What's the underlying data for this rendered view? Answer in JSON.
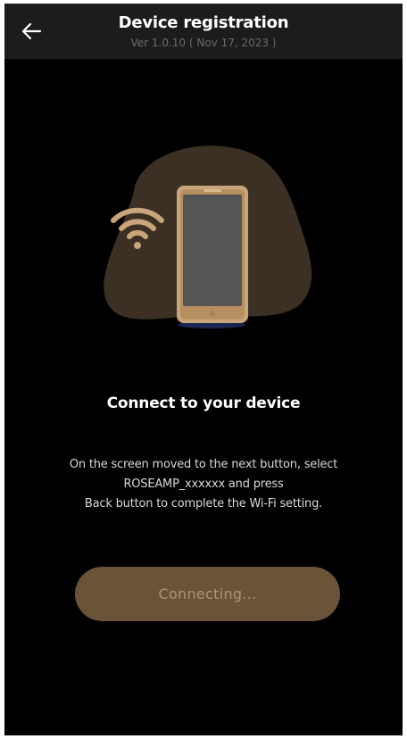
{
  "header": {
    "title": "Device registration",
    "version": "Ver 1.0.10 ( Nov 17, 2023 )",
    "back_icon": "arrow-left-icon"
  },
  "illustration": {
    "icons": [
      "wifi-icon",
      "smartphone-icon"
    ],
    "colors": {
      "blob": "#3b3023",
      "phone_body": "#c8a57b",
      "phone_screen": "#555555",
      "wifi": "#c8a57b"
    }
  },
  "main": {
    "heading": "Connect to your device",
    "description_lines": [
      "On the screen moved to the next button, select",
      "ROSEAMP_xxxxxx and press",
      "Back button to complete the Wi-Fi setting."
    ]
  },
  "button": {
    "label": "Connecting...",
    "color": "#6a5336",
    "text_color": "#a8957a"
  },
  "colors": {
    "background": "#000000",
    "header_bg": "#1c1c1c",
    "title": "#ffffff",
    "subtitle": "#6a6a6a"
  }
}
